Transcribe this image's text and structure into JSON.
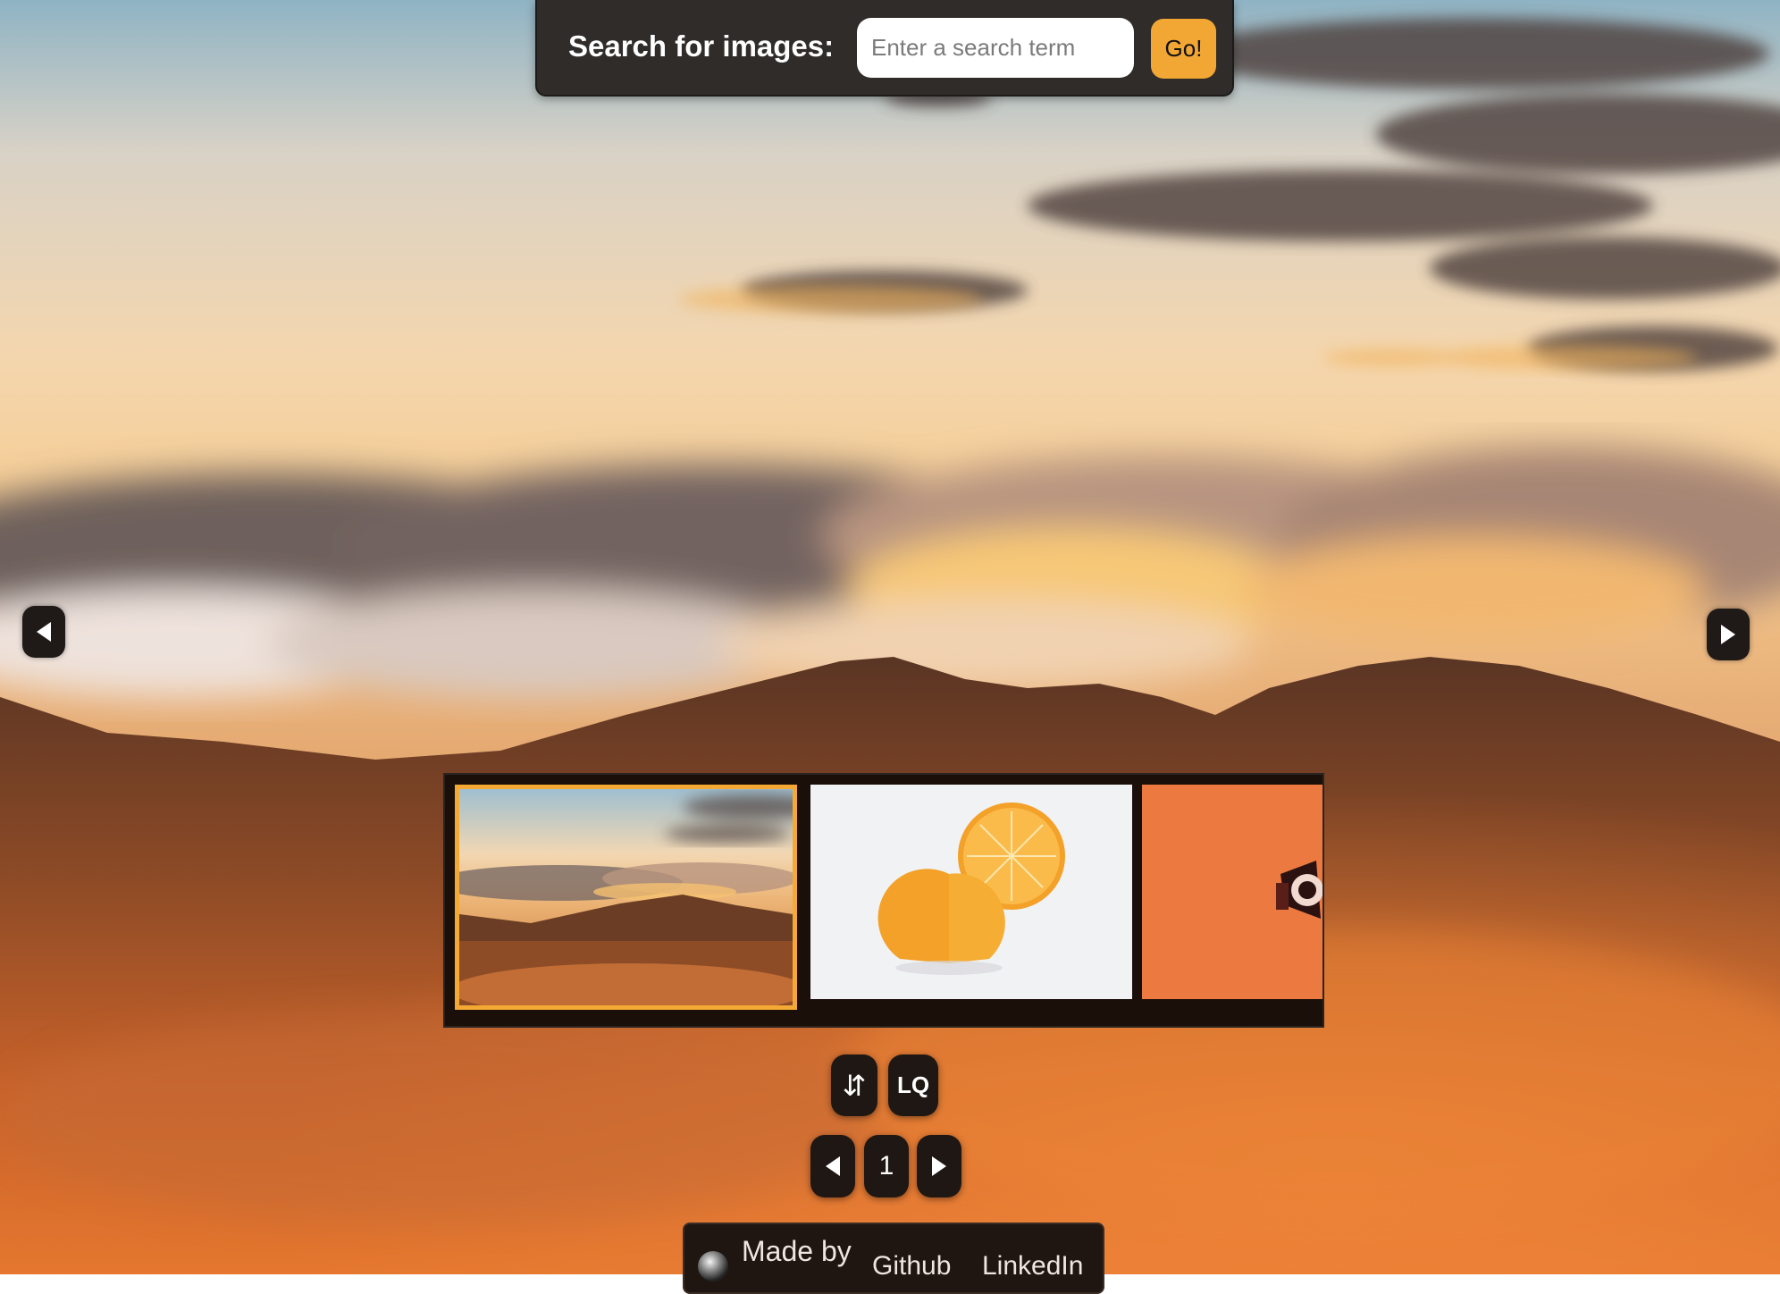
{
  "search": {
    "label": "Search for images:",
    "placeholder": "Enter a search term",
    "value": "",
    "go_label": "Go!"
  },
  "navigation": {
    "prev_icon": "triangle-left-icon",
    "next_icon": "triangle-right-icon"
  },
  "thumbnails": [
    {
      "subject": "mountain sunset",
      "selected": true
    },
    {
      "subject": "orange slices",
      "selected": false
    },
    {
      "subject": "megaphone on orange background",
      "selected": false
    }
  ],
  "controls": {
    "sort_label": "⇵",
    "quality_label": "LQ"
  },
  "pagination": {
    "current_page": "1"
  },
  "footer": {
    "made_by": "Made by",
    "github": "Github",
    "linkedin": "LinkedIn"
  },
  "colors": {
    "accent": "#f2a735",
    "panel": "#2f2c29",
    "control": "#1f1713"
  }
}
